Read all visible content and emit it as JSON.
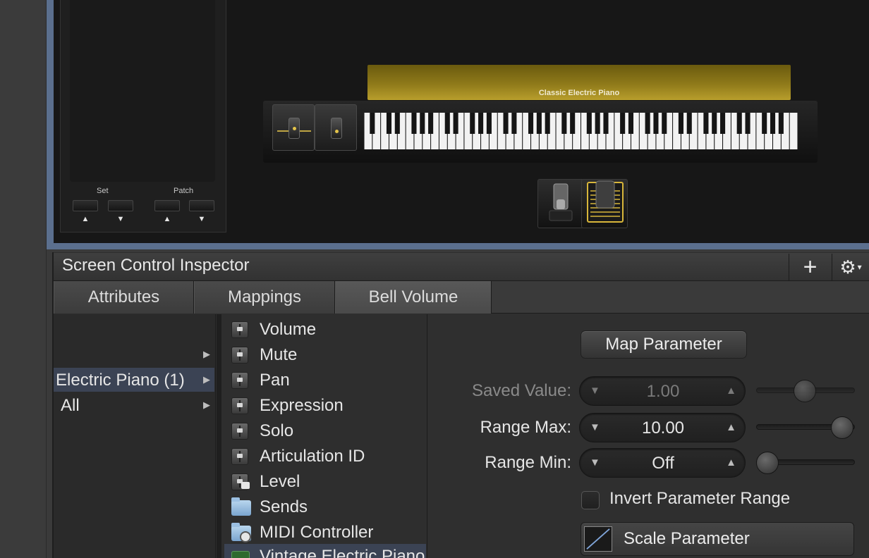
{
  "stage": {
    "instrument_label": "Classic Electric Piano",
    "set_label": "Set",
    "patch_label": "Patch",
    "up_arrow": "▲",
    "down_arrow": "▼"
  },
  "inspector": {
    "title": "Screen Control Inspector",
    "add_glyph": "+",
    "gear_glyph": "⚙",
    "gear_caret": "▾",
    "tabs": [
      {
        "label": "Attributes",
        "active": false
      },
      {
        "label": "Mappings",
        "active": false
      },
      {
        "label": "Bell Volume",
        "active": true
      }
    ]
  },
  "browser": {
    "column1": [
      {
        "label": "",
        "has_arrow": true,
        "selected": false
      },
      {
        "label": "Electric Piano (1)",
        "has_arrow": true,
        "selected": true
      },
      {
        "label": "All",
        "has_arrow": true,
        "selected": false
      }
    ],
    "arrow_glyph": "▶",
    "column2": [
      {
        "label": "Volume",
        "icon": "fader-icon"
      },
      {
        "label": "Mute",
        "icon": "fader-icon"
      },
      {
        "label": "Pan",
        "icon": "fader-icon"
      },
      {
        "label": "Expression",
        "icon": "fader-icon"
      },
      {
        "label": "Solo",
        "icon": "fader-icon"
      },
      {
        "label": "Articulation ID",
        "icon": "fader-icon"
      },
      {
        "label": "Level",
        "icon": "locked-fader-icon"
      },
      {
        "label": "Sends",
        "icon": "folder-icon"
      },
      {
        "label": "MIDI Controller",
        "icon": "midi-folder-icon"
      },
      {
        "label": "Vintage Electric Piano",
        "icon": "instrument-icon",
        "selected": true
      }
    ]
  },
  "mapping": {
    "map_button": "Map Parameter",
    "saved_value": {
      "label": "Saved Value:",
      "value": "1.00",
      "enabled": false,
      "slider_level": 0.5
    },
    "range_max": {
      "label": "Range Max:",
      "value": "10.00",
      "enabled": true,
      "slider_level": 1.0
    },
    "range_min": {
      "label": "Range Min:",
      "value": "Off",
      "enabled": true,
      "slider_level": 0.0
    },
    "invert_label": "Invert Parameter Range",
    "invert_checked": false,
    "scale_button": "Scale Parameter"
  },
  "colors": {
    "accent_blue": "#5b6f8e",
    "gold": "#8f7a1a",
    "selection": "#3b4354",
    "dim_text": "#8a8a8a"
  }
}
